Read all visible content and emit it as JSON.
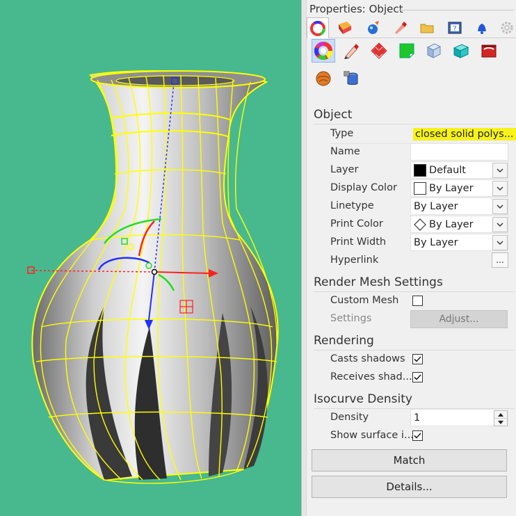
{
  "panel": {
    "title": "Properties: Object"
  },
  "object_section": {
    "title": "Object",
    "rows": [
      {
        "label": "Type",
        "value": "closed solid polys..."
      },
      {
        "label": "Name",
        "value": ""
      },
      {
        "label": "Layer",
        "value": "Default"
      },
      {
        "label": "Display Color",
        "value": "By Layer"
      },
      {
        "label": "Linetype",
        "value": "By Layer"
      },
      {
        "label": "Print Color",
        "value": "By Layer"
      },
      {
        "label": "Print Width",
        "value": "By Layer"
      },
      {
        "label": "Hyperlink",
        "value": ""
      }
    ],
    "hyperlink_button": "..."
  },
  "render_mesh_section": {
    "title": "Render Mesh Settings",
    "custom_mesh_label": "Custom Mesh",
    "custom_mesh_checked": false,
    "settings_label": "Settings",
    "adjust_button": "Adjust..."
  },
  "rendering_section": {
    "title": "Rendering",
    "casts_label": "Casts shadows",
    "casts_checked": true,
    "receives_label": "Receives shad...",
    "receives_checked": true
  },
  "isocurve_section": {
    "title": "Isocurve Density",
    "density_label": "Density",
    "density_value": "1",
    "show_surface_label": "Show surface i...",
    "show_surface_checked": true
  },
  "buttons": {
    "match": "Match",
    "details": "Details..."
  },
  "colors": {
    "viewport_bg": "#48b98f",
    "wire": "#ffff00",
    "highlight": "#f7f21a",
    "x_axis": "#ff0000",
    "y_axis": "#00cc00",
    "z_axis": "#0000ff"
  },
  "icons": {
    "tabs": [
      "color-wheel-icon",
      "material-icon",
      "texture-mapping-icon",
      "decal-pen-icon",
      "folder-icon",
      "help-icon",
      "notification-bell-icon",
      "settings-gear-icon"
    ],
    "pages": [
      "color-wheel-icon",
      "pencil-icon",
      "checker-texture-icon",
      "green-decal-icon",
      "glass-cube-icon",
      "cyan-box-icon",
      "red-box-icon",
      "orange-sphere-icon",
      "database-icon"
    ]
  }
}
